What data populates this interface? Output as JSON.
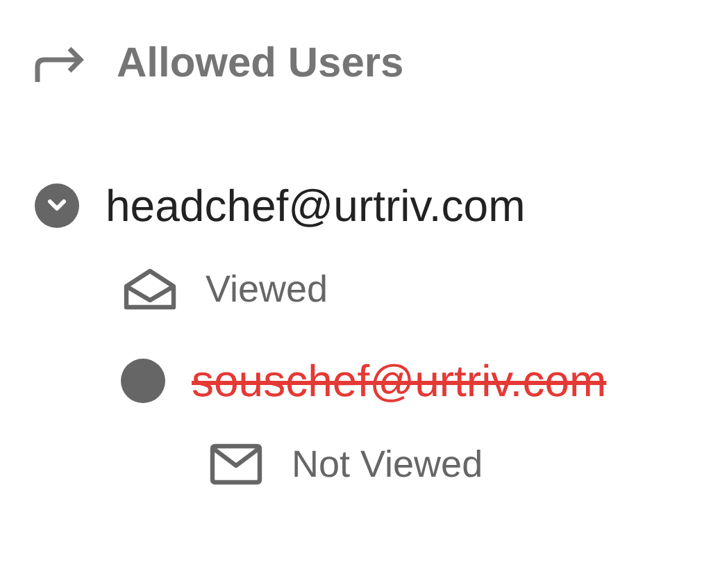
{
  "header": {
    "title": "Allowed Users"
  },
  "users": [
    {
      "kind": "expandable",
      "expanded": true,
      "email": "headchef@urtriv.com",
      "revoked": false,
      "status": {
        "viewed": true,
        "label": "Viewed"
      },
      "children": [
        {
          "kind": "plain",
          "email": "souschef@urtriv.com",
          "revoked": true,
          "status": {
            "viewed": false,
            "label": "Not Viewed"
          }
        }
      ]
    }
  ]
}
